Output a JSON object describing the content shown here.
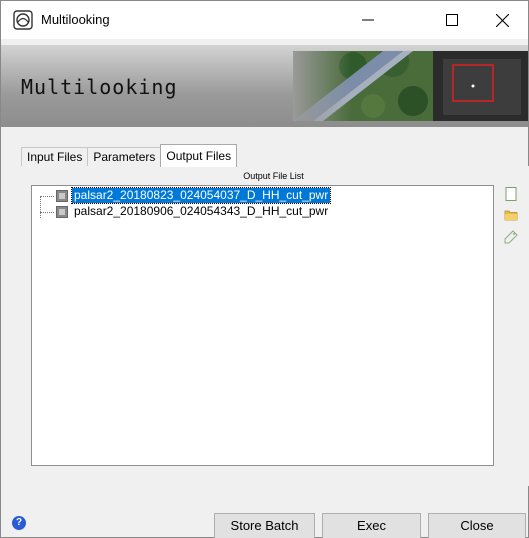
{
  "window": {
    "title": "Multilooking",
    "icons": {
      "app": "app-icon",
      "minimize": "minimize-icon",
      "maximize": "maximize-icon",
      "close": "close-icon"
    }
  },
  "banner": {
    "title": "Multilooking"
  },
  "tabs": [
    {
      "label": "Input Files",
      "active": false
    },
    {
      "label": "Parameters",
      "active": false
    },
    {
      "label": "Output Files",
      "active": true
    }
  ],
  "output": {
    "caption": "Output File List",
    "files": [
      {
        "name": "palsar2_20180823_024054037_D_HH_cut_pwr",
        "selected": true
      },
      {
        "name": "palsar2_20180906_024054343_D_HH_cut_pwr",
        "selected": false
      }
    ],
    "tools": [
      "new-file-icon",
      "open-folder-icon",
      "tag-icon"
    ]
  },
  "footer": {
    "help": "?",
    "store_batch": "Store Batch",
    "exec": "Exec",
    "close": "Close"
  },
  "colors": {
    "selection": "#0078d7",
    "help": "#2a5bd7"
  }
}
